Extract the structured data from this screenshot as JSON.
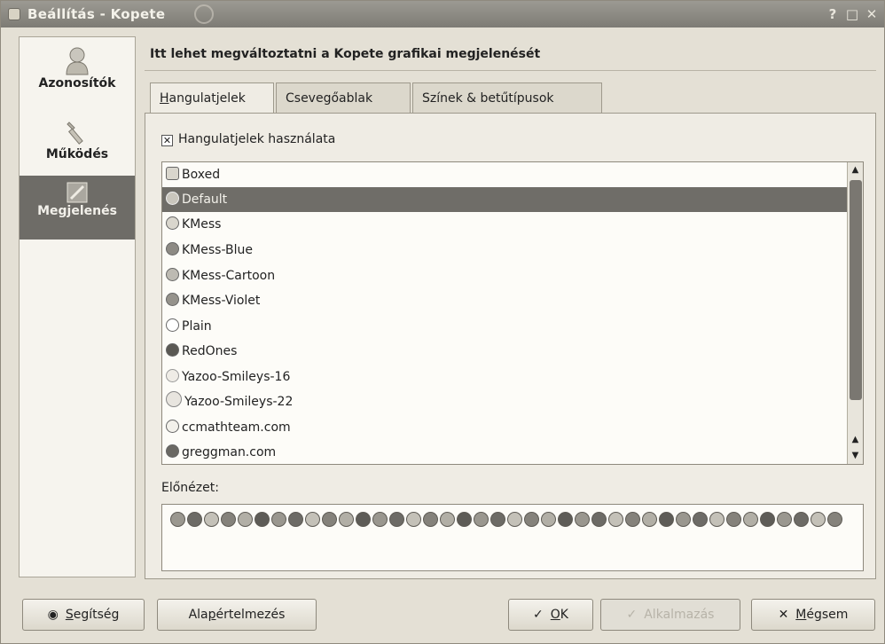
{
  "window": {
    "title": "Beállítás - Kopete",
    "controls": [
      "?",
      "□",
      "✕"
    ]
  },
  "sidebar": {
    "items": [
      {
        "label": "Azonosítók",
        "icon": "user-icon"
      },
      {
        "label": "Működés",
        "icon": "wrench-icon"
      },
      {
        "label": "Megjelenés",
        "icon": "appearance-icon",
        "active": true
      }
    ]
  },
  "header": {
    "title": "Itt lehet megváltoztatni a Kopete grafikai megjelenését"
  },
  "tabs": [
    {
      "prefix": "",
      "underline": "H",
      "rest": "angulatjelek",
      "active": true
    },
    {
      "prefix": "",
      "underline": "",
      "rest": "Csevegőablak",
      "active": false
    },
    {
      "prefix": "",
      "underline": "",
      "rest": "Színek & betűtípusok",
      "active": false
    }
  ],
  "emoticons": {
    "checkbox": {
      "mark": "✕",
      "underline": "H",
      "rest": "angulatjelek használata",
      "checked": true
    },
    "themes": [
      "Boxed",
      "Default",
      "KMess",
      "KMess-Blue",
      "KMess-Cartoon",
      "KMess-Violet",
      "Plain",
      "RedOnes",
      "Yazoo-Smileys-16",
      "Yazoo-Smileys-22",
      "ccmathteam.com",
      "greggman.com"
    ],
    "selected_index": 1,
    "preview_label": "Előnézet:",
    "preview_count": 40
  },
  "buttons": {
    "help": {
      "icon": "help-icon",
      "prefix": "",
      "underline": "S",
      "rest": "egítség"
    },
    "defaults": {
      "prefix": "Ala",
      "underline": "p",
      "rest": "értelmezés"
    },
    "ok": {
      "icon": "check-icon",
      "prefix": "",
      "underline": "O",
      "rest": "K"
    },
    "apply": {
      "icon": "check-icon",
      "label": "Alkalmazás"
    },
    "cancel": {
      "icon": "x-icon",
      "prefix": "",
      "underline": "M",
      "rest": "égsem"
    }
  }
}
